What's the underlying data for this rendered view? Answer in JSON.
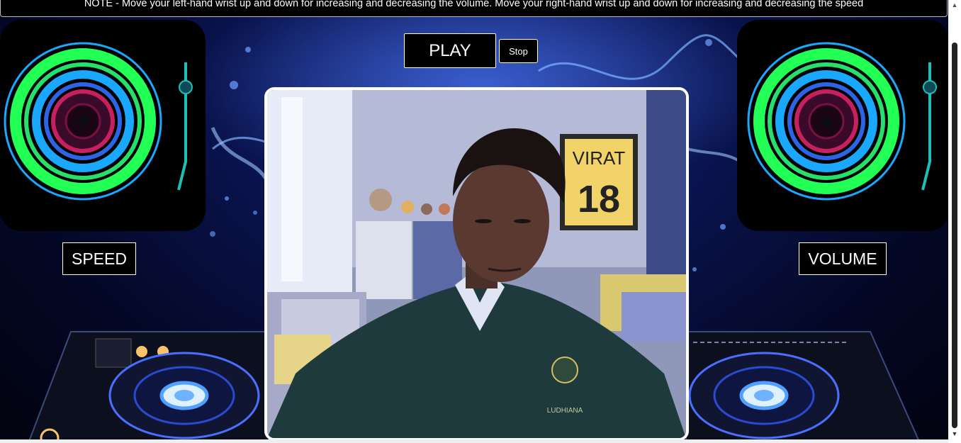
{
  "note": {
    "text": "NOTE - Move your left-hand wrist up and down for increasing and decreasing the volume. Move your right-hand wrist up and down for increasing and decreasing the speed"
  },
  "controls": {
    "play_label": "PLAY",
    "stop_label": "Stop",
    "speed_label": "SPEED",
    "volume_label": "VOLUME"
  },
  "webcam": {
    "poster_line1": "VIRAT",
    "poster_line2": "18",
    "badge_text": "LUDHIANA"
  },
  "colors": {
    "background": "#0a1450",
    "ring_green": "#22ff55",
    "ring_blue": "#1aa8ff",
    "ring_magenta": "#c8205e",
    "button_bg": "#000000",
    "button_text": "#ffffff"
  },
  "icons": {
    "left_disc": "speed-turntable-icon",
    "right_disc": "volume-turntable-icon",
    "scroll_up": "scroll-up-arrow-icon",
    "scroll_down": "scroll-down-arrow-icon"
  }
}
